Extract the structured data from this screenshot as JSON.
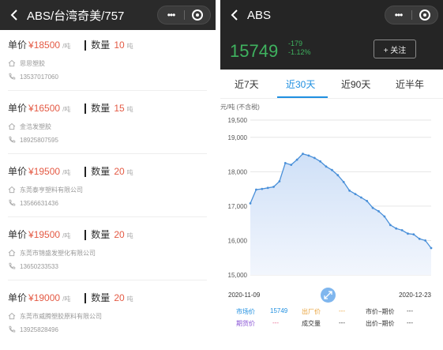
{
  "left": {
    "title": "ABS/台湾奇美/757",
    "price_label": "单价",
    "qty_label": "数量",
    "listings": [
      {
        "price": "¥18500",
        "unit": "/吨",
        "qty": "10",
        "qty_unit": "吨",
        "company": "思思塑胶",
        "phone": "13537017060"
      },
      {
        "price": "¥16500",
        "unit": "/吨",
        "qty": "15",
        "qty_unit": "吨",
        "company": "金浩发塑胶",
        "phone": "18925807595"
      },
      {
        "price": "¥19500",
        "unit": "/吨",
        "qty": "20",
        "qty_unit": "吨",
        "company": "东莞泰亨塑料有限公司",
        "phone": "13566631436"
      },
      {
        "price": "¥19500",
        "unit": "/吨",
        "qty": "20",
        "qty_unit": "吨",
        "company": "东莞市锦盛发塑化有限公司",
        "phone": "13650233533"
      },
      {
        "price": "¥19000",
        "unit": "/吨",
        "qty": "20",
        "qty_unit": "吨",
        "company": "东莞市威腾塑胶原料有限公司",
        "phone": "13925828496"
      }
    ]
  },
  "right": {
    "title": "ABS",
    "price": "15749",
    "change": "-179",
    "change_pct": "-1.12%",
    "follow_label": "+ 关注",
    "tabs": [
      "近7天",
      "近30天",
      "近90天",
      "近半年"
    ],
    "active_tab": 1,
    "footer": {
      "market_label": "市场价",
      "market_value": "15749",
      "factory_label": "出厂价",
      "factory_value": "---",
      "spread1_label": "市价−期价",
      "spread1_value": "---",
      "futures_label": "期货价",
      "futures_value": "---",
      "volume_label": "成交量",
      "volume_value": "---",
      "spread2_label": "出价−期价",
      "spread2_value": "---"
    }
  },
  "colors": {
    "accent": "#1f8fe0",
    "up_green": "#3fb25f",
    "price_red": "#e45a44",
    "header_dark": "#2a2a2a",
    "line": "#4a90d9"
  },
  "chart_data": {
    "type": "area",
    "ylabel": "元/吨 (不含税)",
    "ylim": [
      15000,
      19500
    ],
    "yticks": [
      "19,500",
      "19,000",
      "18,000",
      "17,000",
      "16,000",
      "15,000"
    ],
    "ytick_values": [
      19500,
      19000,
      18000,
      17000,
      16000,
      15000
    ],
    "x_start": "2020-11-09",
    "x_end": "2020-12-23",
    "series": [
      {
        "values": [
          17080,
          17480,
          17500,
          17530,
          17560,
          17720,
          18250,
          18200,
          18350,
          18520,
          18470,
          18400,
          18300,
          18150,
          18050,
          17900,
          17700,
          17450,
          17350,
          17250,
          17150,
          16950,
          16850,
          16700,
          16450,
          16350,
          16300,
          16200,
          16180,
          16050,
          16000,
          15780
        ]
      }
    ]
  }
}
